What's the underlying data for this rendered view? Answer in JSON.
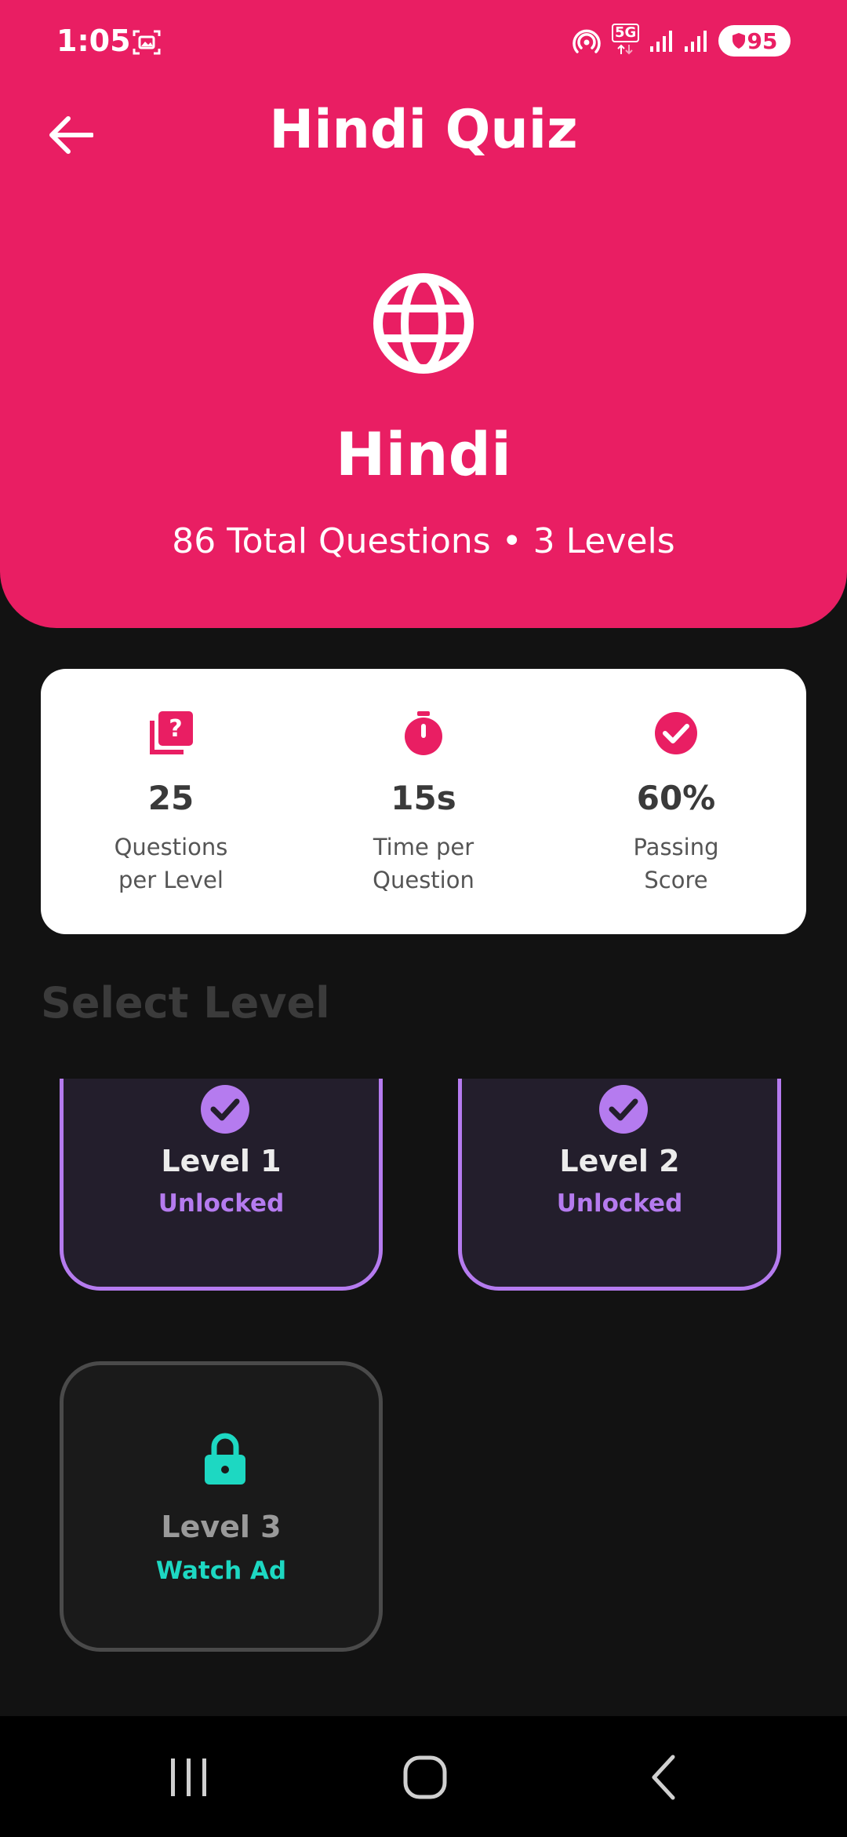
{
  "colors": {
    "primary": "#E91E63",
    "unlocked_accent": "#B57BEF",
    "ad_accent": "#1DD8C2",
    "background": "#121212"
  },
  "status_bar": {
    "time": "1:05",
    "network": "5G",
    "battery": "95"
  },
  "header": {
    "title": "Hindi Quiz",
    "subject_icon": "globe-icon",
    "subject": "Hindi",
    "meta": "86 Total Questions • 3 Levels"
  },
  "stats": [
    {
      "icon": "quiz-icon",
      "value": "25",
      "label_line1": "Questions",
      "label_line2": "per Level"
    },
    {
      "icon": "timer-icon",
      "value": "15s",
      "label_line1": "Time per",
      "label_line2": "Question"
    },
    {
      "icon": "check-circle-icon",
      "value": "60%",
      "label_line1": "Passing",
      "label_line2": "Score"
    }
  ],
  "section_title": "Select Level",
  "levels": [
    {
      "name": "Level 1",
      "status": "Unlocked",
      "icon": "check-circle-icon"
    },
    {
      "name": "Level 2",
      "status": "Unlocked",
      "icon": "check-circle-icon"
    },
    {
      "name": "Level 3",
      "status": "Watch Ad",
      "icon": "lock-icon"
    }
  ]
}
